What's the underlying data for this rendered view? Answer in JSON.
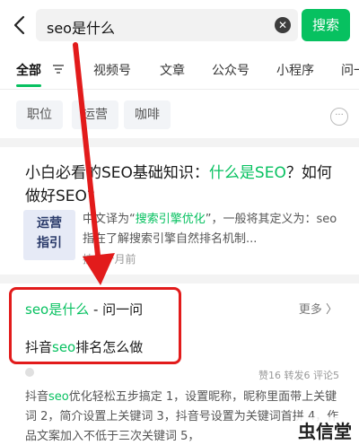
{
  "search": {
    "query": "seo是什么",
    "button_label": "搜索"
  },
  "tabs": [
    {
      "label": "全部"
    },
    {
      "label": "视频号"
    },
    {
      "label": "文章"
    },
    {
      "label": "公众号"
    },
    {
      "label": "小程序"
    },
    {
      "label": "问一"
    }
  ],
  "chips": [
    {
      "label": "职位"
    },
    {
      "label": "运营"
    },
    {
      "label": "咖啡"
    }
  ],
  "article": {
    "title_before": "小白必看的SEO基础知识：",
    "title_highlight": "什么是SEO",
    "title_after": "？如何做好SEO?",
    "thumb_line1": "运营",
    "thumb_line2": "指引",
    "snippet_before": "中文译为“",
    "snippet_highlight": "搜索引擎优化",
    "snippet_after": "”，一般将其定义为：seo指在了解搜索引擎自然排名机制...",
    "meta": "技  3个月前"
  },
  "qa": {
    "title_highlight": "seo是什么",
    "title_rest": " - 问一问",
    "more_label": "更多 〉",
    "question_before": "抖音",
    "question_highlight": "seo",
    "question_after": "排名怎么做",
    "stats": "赞16 转发6 评论5",
    "answer_before": "抖音",
    "answer_highlight": "seo",
    "answer_after": "优化轻松五步搞定 1，设置昵称，昵称里面带上关键词 2，简介设置上关键词 3，抖音号设置为关键词首拼 4，作品文案加入不低于三次关键词 5，"
  },
  "watermark": "虫信堂",
  "colors": {
    "accent": "#07c160",
    "annotation_red": "#e21b1b"
  }
}
